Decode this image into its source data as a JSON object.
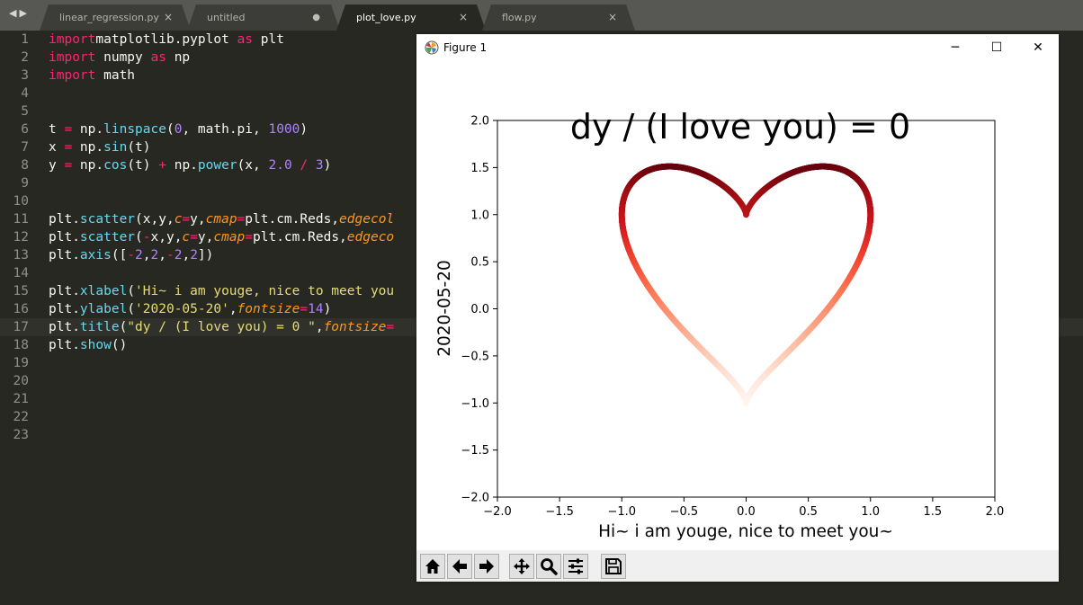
{
  "tabs": [
    {
      "label": "linear_regression.py",
      "state": "close",
      "active": false
    },
    {
      "label": "untitled",
      "state": "modified",
      "active": false
    },
    {
      "label": "plot_love.py",
      "state": "close",
      "active": true
    },
    {
      "label": "flow.py",
      "state": "close",
      "active": false
    }
  ],
  "tab_close_glyph": "×",
  "tab_modified_glyph": "●",
  "nav_glyphs": "◀▶",
  "editor": {
    "current_line": 17,
    "lines": [
      [
        [
          "kw",
          "import"
        ],
        [
          "",
          "matplotlib.pyplot "
        ],
        [
          "kw",
          "as"
        ],
        [
          "",
          " plt"
        ]
      ],
      [
        [
          "kw",
          "import"
        ],
        [
          "",
          " numpy "
        ],
        [
          "kw",
          "as"
        ],
        [
          "",
          " np"
        ]
      ],
      [
        [
          "kw",
          "import"
        ],
        [
          "",
          " math"
        ]
      ],
      [],
      [],
      [
        [
          "",
          "t "
        ],
        [
          "kw",
          "="
        ],
        [
          "",
          " np."
        ],
        [
          "fn",
          "linspace"
        ],
        [
          "",
          "("
        ],
        [
          "num",
          "0"
        ],
        [
          "",
          ", math.pi, "
        ],
        [
          "num",
          "1000"
        ],
        [
          "",
          ")"
        ]
      ],
      [
        [
          "",
          "x "
        ],
        [
          "kw",
          "="
        ],
        [
          "",
          " np."
        ],
        [
          "fn",
          "sin"
        ],
        [
          "",
          "(t)"
        ]
      ],
      [
        [
          "",
          "y "
        ],
        [
          "kw",
          "="
        ],
        [
          "",
          " np."
        ],
        [
          "fn",
          "cos"
        ],
        [
          "",
          "(t) "
        ],
        [
          "kw",
          "+"
        ],
        [
          "",
          " np."
        ],
        [
          "fn",
          "power"
        ],
        [
          "",
          "(x, "
        ],
        [
          "num",
          "2.0"
        ],
        [
          "",
          " "
        ],
        [
          "kw",
          "/"
        ],
        [
          "",
          " "
        ],
        [
          "num",
          "3"
        ],
        [
          "",
          ")"
        ]
      ],
      [],
      [],
      [
        [
          "",
          "plt."
        ],
        [
          "fn",
          "scatter"
        ],
        [
          "",
          "(x,y,"
        ],
        [
          "arg",
          "c"
        ],
        [
          "kw",
          "="
        ],
        [
          "",
          "y,"
        ],
        [
          "arg",
          "cmap"
        ],
        [
          "kw",
          "="
        ],
        [
          "",
          "plt.cm.Reds,"
        ],
        [
          "arg",
          "edgecol"
        ]
      ],
      [
        [
          "",
          "plt."
        ],
        [
          "fn",
          "scatter"
        ],
        [
          "",
          "("
        ],
        [
          "kw",
          "-"
        ],
        [
          "",
          "x,y,"
        ],
        [
          "arg",
          "c"
        ],
        [
          "kw",
          "="
        ],
        [
          "",
          "y,"
        ],
        [
          "arg",
          "cmap"
        ],
        [
          "kw",
          "="
        ],
        [
          "",
          "plt.cm.Reds,"
        ],
        [
          "arg",
          "edgeco"
        ]
      ],
      [
        [
          "",
          "plt."
        ],
        [
          "fn",
          "axis"
        ],
        [
          "",
          "(["
        ],
        [
          "kw",
          "-"
        ],
        [
          "num",
          "2"
        ],
        [
          "",
          ","
        ],
        [
          "num",
          "2"
        ],
        [
          "",
          ","
        ],
        [
          "kw",
          "-"
        ],
        [
          "num",
          "2"
        ],
        [
          "",
          ","
        ],
        [
          "num",
          "2"
        ],
        [
          "",
          "])"
        ]
      ],
      [],
      [
        [
          "",
          "plt."
        ],
        [
          "fn",
          "xlabel"
        ],
        [
          "",
          "("
        ],
        [
          "str",
          "'Hi~ i am youge, nice to meet you"
        ]
      ],
      [
        [
          "",
          "plt."
        ],
        [
          "fn",
          "ylabel"
        ],
        [
          "",
          "("
        ],
        [
          "str",
          "'2020-05-20'"
        ],
        [
          "",
          ","
        ],
        [
          "arg",
          "fontsize"
        ],
        [
          "kw",
          "="
        ],
        [
          "num",
          "14"
        ],
        [
          "",
          ")"
        ]
      ],
      [
        [
          "",
          "plt."
        ],
        [
          "fn",
          "title"
        ],
        [
          "",
          "("
        ],
        [
          "str",
          "\"dy / (I love you) = 0 \""
        ],
        [
          "",
          ","
        ],
        [
          "arg",
          "fontsize"
        ],
        [
          "kw",
          "="
        ]
      ],
      [
        [
          "",
          "plt."
        ],
        [
          "fn",
          "show"
        ],
        [
          "",
          "()"
        ]
      ],
      [],
      [],
      [],
      [],
      []
    ]
  },
  "figure_window": {
    "title": "Figure 1",
    "buttons": {
      "minimize": "─",
      "maximize": "☐",
      "close": "✕"
    }
  },
  "chart_data": {
    "type": "scatter",
    "title": "dy / (I love you) = 0",
    "xlabel": "Hi~ i am youge, nice to meet you~",
    "ylabel": "2020-05-20",
    "xlim": [
      -2.0,
      2.0
    ],
    "ylim": [
      -2.0,
      2.0
    ],
    "xticks": [
      "−2.0",
      "−1.5",
      "−1.0",
      "−0.5",
      "0.0",
      "0.5",
      "1.0",
      "1.5",
      "2.0"
    ],
    "yticks": [
      "−2.0",
      "−1.5",
      "−1.0",
      "−0.5",
      "0.0",
      "0.5",
      "1.0",
      "1.5",
      "2.0"
    ],
    "grid": false,
    "colormap": "Reds",
    "color_by": "y",
    "num_points": 1000,
    "series": [
      {
        "x_expr": "sin(t)",
        "y_expr": "cos(t) + sin(t)^(2/3)",
        "t_range": [
          0,
          3.14159
        ]
      },
      {
        "x_expr": "-sin(t)",
        "y_expr": "cos(t) + sin(t)^(2/3)",
        "t_range": [
          0,
          3.14159
        ]
      }
    ]
  },
  "toolbar": [
    "home-icon",
    "back-icon",
    "forward-icon",
    "pan-icon",
    "zoom-icon",
    "configure-icon",
    "save-icon"
  ]
}
